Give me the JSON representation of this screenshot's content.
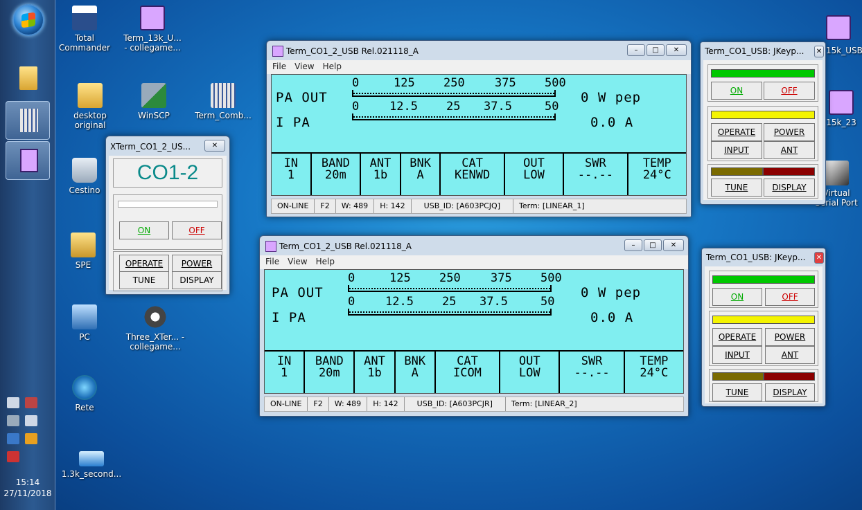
{
  "taskbar": {
    "time": "15:14",
    "date": "27/11/2018"
  },
  "desktop_icons": [
    {
      "label": "Total Commander"
    },
    {
      "label": "Term_13k_U... - collegame..."
    },
    {
      "label": "desktop original"
    },
    {
      "label": "WinSCP"
    },
    {
      "label": "Term_Comb..."
    },
    {
      "label": "Cestino"
    },
    {
      "label": "SPE"
    },
    {
      "label": "PC"
    },
    {
      "label": "Three_XTer... - collegame..."
    },
    {
      "label": "Rete"
    },
    {
      "label": "1.3k_second..."
    },
    {
      "label": "15k_USB"
    },
    {
      "label": "15k_23"
    },
    {
      "label": "Virtual Serial Port"
    }
  ],
  "xterm": {
    "title": "XTerm_CO1_2_US...",
    "name": "CO1-2",
    "on": "ON",
    "off": "OFF",
    "operate": "OPERATE",
    "power": "POWER",
    "tune": "TUNE",
    "display": "DISPLAY"
  },
  "term1": {
    "title": "Term_CO1_2_USB  Rel.021118_A",
    "menu": [
      "File",
      "View",
      "Help"
    ],
    "pa_out_label": "PA OUT",
    "pa_out_scale": [
      "0",
      "125",
      "250",
      "375",
      "500"
    ],
    "pa_out_value": "0 W pep",
    "ipa_label": "I PA",
    "ipa_scale": [
      "0",
      "12.5",
      "25",
      "37.5",
      "50"
    ],
    "ipa_value": "0.0 A",
    "cols": [
      [
        "IN",
        "1"
      ],
      [
        "BAND",
        "20m"
      ],
      [
        "ANT",
        "1b"
      ],
      [
        "BNK",
        "A"
      ],
      [
        "CAT",
        "KENWD"
      ],
      [
        "OUT",
        "LOW"
      ],
      [
        "SWR",
        "--.--"
      ],
      [
        "TEMP",
        "24°C"
      ]
    ],
    "status": [
      "ON-LINE",
      "F2",
      "W: 489",
      "H: 142",
      "USB_ID: [A603PCJQ]",
      "Term: [LINEAR_1]"
    ]
  },
  "term2": {
    "title": "Term_CO1_2_USB  Rel.021118_A",
    "menu": [
      "File",
      "View",
      "Help"
    ],
    "pa_out_label": "PA OUT",
    "pa_out_scale": [
      "0",
      "125",
      "250",
      "375",
      "500"
    ],
    "pa_out_value": "0 W pep",
    "ipa_label": "I PA",
    "ipa_scale": [
      "0",
      "12.5",
      "25",
      "37.5",
      "50"
    ],
    "ipa_value": "0.0 A",
    "cols": [
      [
        "IN",
        "1"
      ],
      [
        "BAND",
        "20m"
      ],
      [
        "ANT",
        "1b"
      ],
      [
        "BNK",
        "A"
      ],
      [
        "CAT",
        "ICOM"
      ],
      [
        "OUT",
        "LOW"
      ],
      [
        "SWR",
        "--.--"
      ],
      [
        "TEMP",
        "24°C"
      ]
    ],
    "status": [
      "ON-LINE",
      "F2",
      "W: 489",
      "H: 142",
      "USB_ID: [A603PCJR]",
      "Term: [LINEAR_2]"
    ]
  },
  "keypad1": {
    "title": "Term_CO1_USB: JKeyp...",
    "on": "ON",
    "off": "OFF",
    "operate": "OPERATE",
    "power": "POWER",
    "input": "INPUT",
    "ant": "ANT",
    "tune": "TUNE",
    "display": "DISPLAY"
  },
  "keypad2": {
    "title": "Term_CO1_USB: JKeyp...",
    "on": "ON",
    "off": "OFF",
    "operate": "OPERATE",
    "power": "POWER",
    "input": "INPUT",
    "ant": "ANT",
    "tune": "TUNE",
    "display": "DISPLAY"
  },
  "colors": {
    "lcd": "#80eef0",
    "green": "#00c800",
    "yellow": "#f4f400",
    "olive": "#7a6a00",
    "darkred": "#8b0000"
  }
}
